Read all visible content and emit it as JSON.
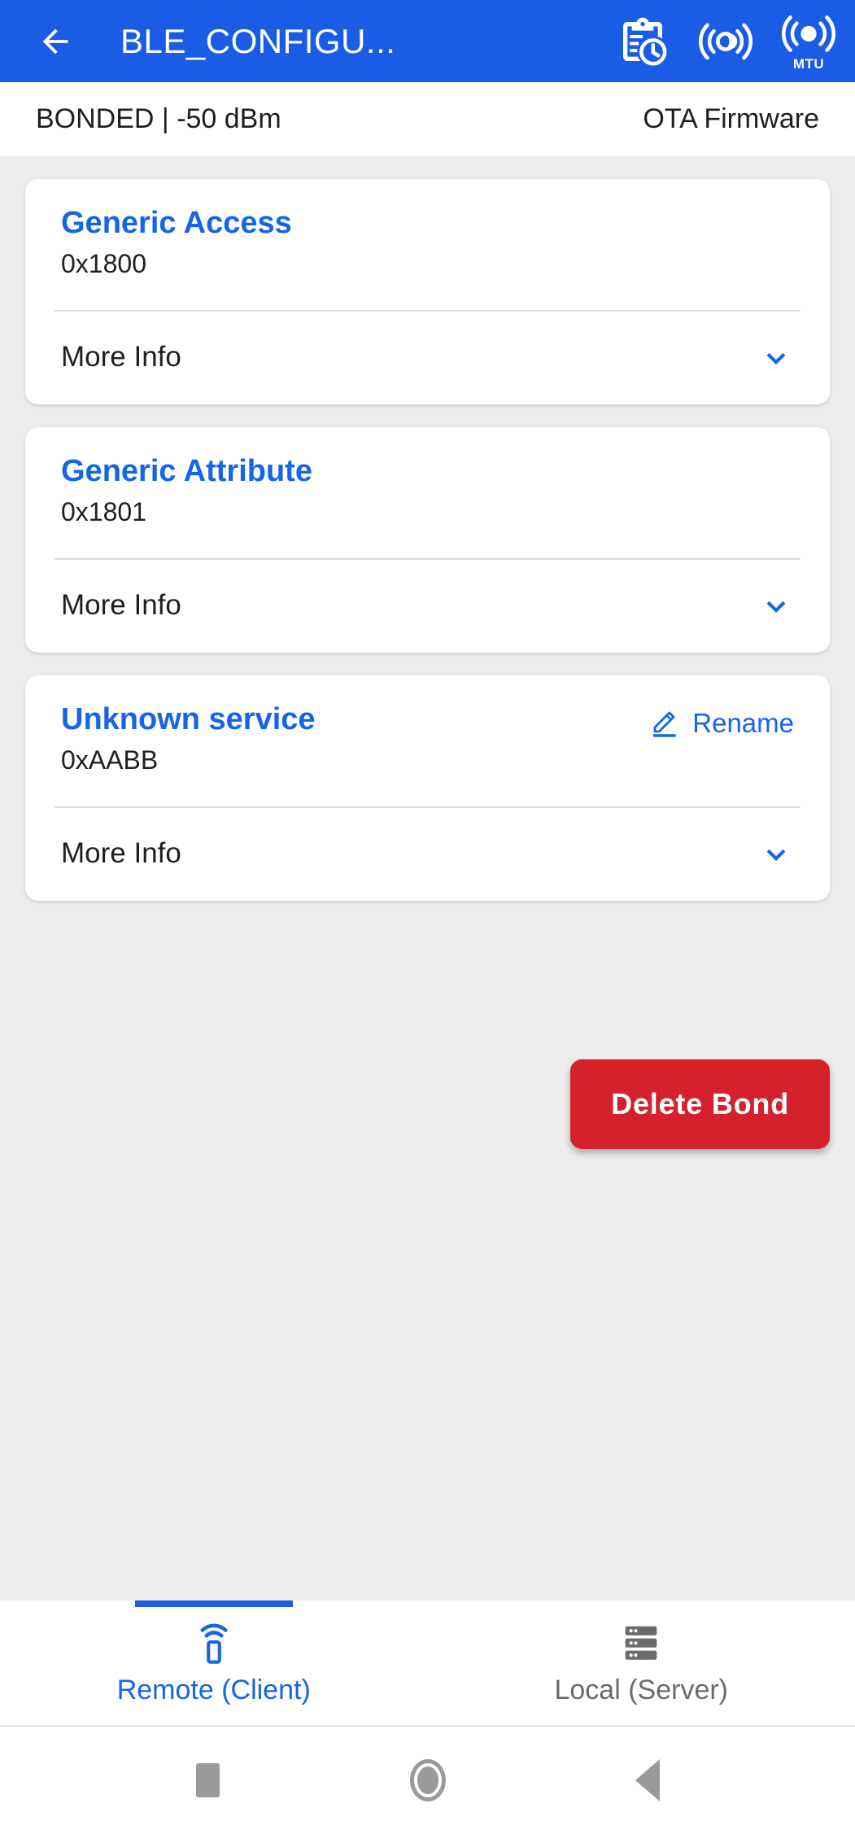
{
  "appbar": {
    "back_icon": "arrow-left-icon",
    "title": "BLE_CONFIGU...",
    "actions": [
      {
        "icon": "clipboard-clock-icon",
        "label": ""
      },
      {
        "icon": "signal-interval-icon",
        "label": ""
      },
      {
        "icon": "signal-mtu-icon",
        "label": "MTU"
      }
    ]
  },
  "subheader": {
    "status": "BONDED | -50 dBm",
    "ota": "OTA Firmware"
  },
  "services": [
    {
      "name": "Generic Access",
      "uuid": "0x1800",
      "more_info": "More Info",
      "expand_icon": "chevron-down-icon",
      "rename": null
    },
    {
      "name": "Generic Attribute",
      "uuid": "0x1801",
      "more_info": "More Info",
      "expand_icon": "chevron-down-icon",
      "rename": null
    },
    {
      "name": "Unknown service",
      "uuid": "0xAABB",
      "more_info": "More Info",
      "expand_icon": "chevron-down-icon",
      "rename": "Rename",
      "rename_icon": "pencil-edit-icon"
    }
  ],
  "actions": {
    "delete_bond": "Delete Bond"
  },
  "tabs": [
    {
      "label": "Remote (Client)",
      "icon": "remote-device-signal-icon",
      "active": true
    },
    {
      "label": "Local (Server)",
      "icon": "server-stack-icon",
      "active": false
    }
  ],
  "navbar": {
    "recents": "recents-square-icon",
    "home": "home-circle-icon",
    "back": "back-triangle-icon"
  },
  "colors": {
    "primary_blue": "#1A5CE6",
    "link_blue": "#1565E8",
    "danger_red": "#D4212C",
    "page_bg": "#ececec",
    "card_bg": "#ffffff",
    "inactive_gray": "#6b6b6b"
  }
}
